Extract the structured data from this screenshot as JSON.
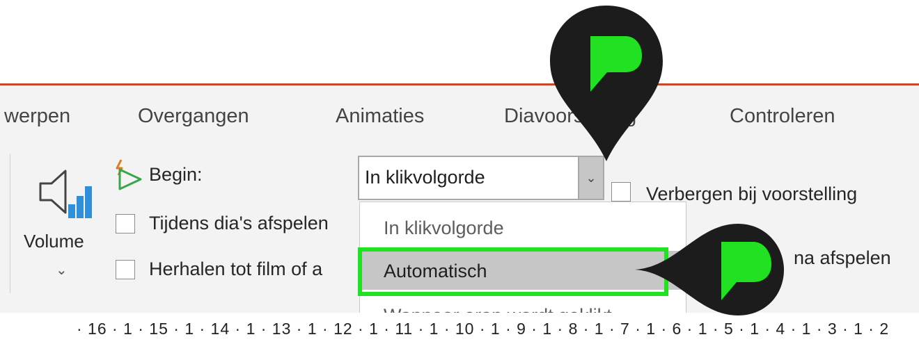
{
  "tabs": [
    {
      "label": "werpen"
    },
    {
      "label": "Overgangen"
    },
    {
      "label": "Animaties"
    },
    {
      "label": "Diavoorstelling"
    },
    {
      "label": "Controleren"
    }
  ],
  "volume": {
    "label": "Volume",
    "chevron": "⌄"
  },
  "begin": {
    "label": "Begin:"
  },
  "start_select": {
    "value": "In klikvolgorde",
    "arrow": "⌄",
    "options": [
      {
        "label": "In klikvolgorde"
      },
      {
        "label": "Automatisch"
      },
      {
        "label": "Wanneer erop wordt geklikt"
      }
    ],
    "highlighted": "Automatisch"
  },
  "checkboxes": {
    "across_slides": "Tijdens dia's afspelen",
    "loop": "Herhalen tot film of a",
    "hide": "Verbergen bij voorstelling",
    "rewind": "na afspelen"
  },
  "ruler": {
    "text": "· 16 · 1 · 15 · 1 · 14 · 1 · 13 · 1 · 12 · 1 · 11 · 1 · 10 · 1 · 9 · 1 · 8 · 1 · 7 · 1 · 6 · 1 · 5 · 1 · 4 · 1 · 3 · 1 · 2"
  },
  "colors": {
    "accent_red": "#c8462a",
    "highlight_green": "#22e022",
    "pin_dark": "#1c1c1c"
  },
  "icons": [
    "speaker-volume-icon",
    "begin-trigger-icon",
    "chevron-down-icon",
    "callout-pin-icon"
  ]
}
